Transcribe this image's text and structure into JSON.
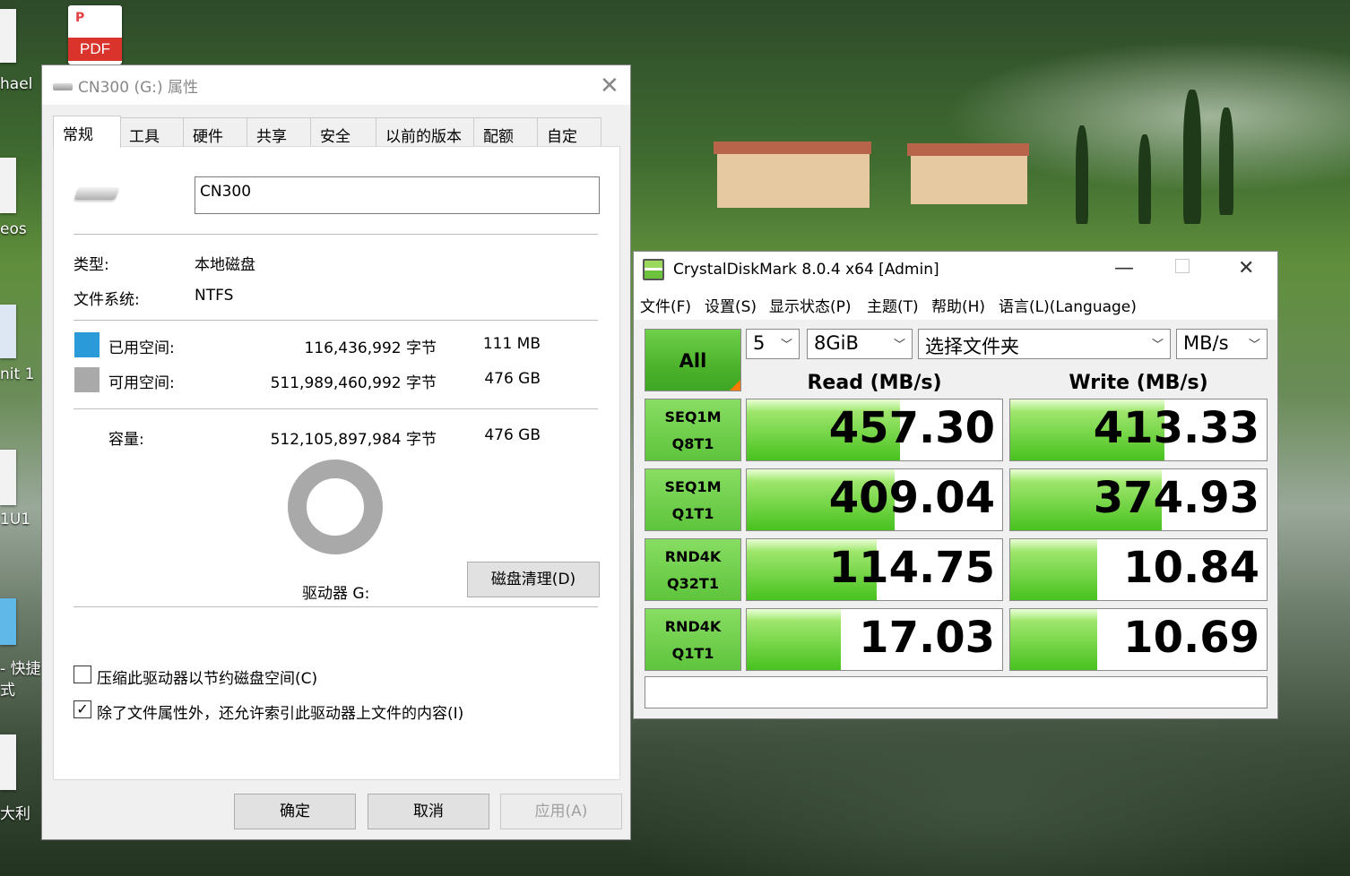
{
  "desktop": {
    "labels": [
      "hael",
      "eos",
      "nit 1",
      "1U1",
      "- 快捷",
      "式",
      "大利"
    ],
    "pdf_label": "PDF",
    "pdf_letter": "P"
  },
  "props": {
    "title": "CN300 (G:) 属性",
    "tabs": [
      "常规",
      "工具",
      "硬件",
      "共享",
      "安全",
      "以前的版本",
      "配额",
      "自定义"
    ],
    "name_value": "CN300",
    "type_label": "类型:",
    "type_value": "本地磁盘",
    "fs_label": "文件系统:",
    "fs_value": "NTFS",
    "used_label": "已用空间:",
    "used_bytes": "116,436,992 字节",
    "used_size": "111 MB",
    "free_label": "可用空间:",
    "free_bytes": "511,989,460,992 字节",
    "free_size": "476 GB",
    "cap_label": "容量:",
    "cap_bytes": "512,105,897,984 字节",
    "cap_size": "476 GB",
    "drive_label": "驱动器 G:",
    "cleanup_button": "磁盘清理(D)",
    "compress_label": "压缩此驱动器以节约磁盘空间(C)",
    "compress_checked": false,
    "index_label": "除了文件属性外，还允许索引此驱动器上文件的内容(I)",
    "index_checked": true,
    "check_mark": "✓",
    "ok_button": "确定",
    "cancel_button": "取消",
    "apply_button": "应用(A)",
    "used_color": "#2a9bd8",
    "free_color": "#a9a9a9",
    "used_fraction": 0.0002
  },
  "cdm": {
    "title": "CrystalDiskMark 8.0.4 x64 [Admin]",
    "menu": [
      "文件(F)",
      "设置(S)",
      "显示状态(P)",
      "主题(T)",
      "帮助(H)",
      "语言(L)(Language)"
    ],
    "all_button": "All",
    "count": "5",
    "size": "8GiB",
    "folder": "选择文件夹",
    "unit": "MB/s",
    "read_header": "Read (MB/s)",
    "write_header": "Write (MB/s)",
    "rows": [
      {
        "line1": "SEQ1M",
        "line2": "Q8T1",
        "read": "457.30",
        "write": "413.33",
        "read_fill": 0.6,
        "write_fill": 0.6
      },
      {
        "line1": "SEQ1M",
        "line2": "Q1T1",
        "read": "409.04",
        "write": "374.93",
        "read_fill": 0.58,
        "write_fill": 0.59
      },
      {
        "line1": "RND4K",
        "line2": "Q32T1",
        "read": "114.75",
        "write": "10.84",
        "read_fill": 0.51,
        "write_fill": 0.34
      },
      {
        "line1": "RND4K",
        "line2": "Q1T1",
        "read": "17.03",
        "write": "10.69",
        "read_fill": 0.37,
        "write_fill": 0.34
      }
    ],
    "comment": ""
  }
}
